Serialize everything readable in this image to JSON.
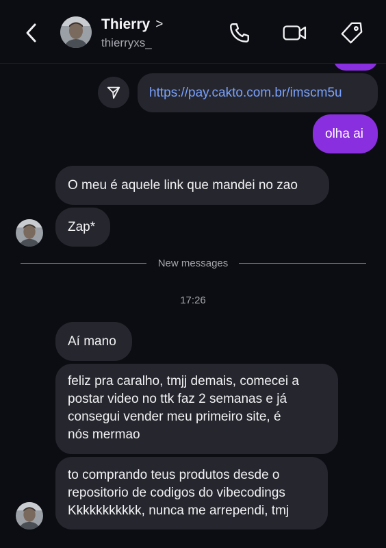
{
  "header": {
    "back_icon": "chevron-left-icon",
    "contact_name": "Thierry",
    "name_chevron": ">",
    "username": "thierryxs_",
    "actions": [
      {
        "icon": "phone-icon"
      },
      {
        "icon": "video-camera-icon"
      },
      {
        "icon": "tag-icon"
      }
    ]
  },
  "messages": {
    "link": "https://pay.cakto.com.br/imscm5u",
    "sent_1": "olha ai",
    "recv_1": "O meu é aquele link que mandei no zao",
    "recv_2": "Zap*",
    "new_messages_label": "New messages",
    "time": "17:26",
    "recv_3": "Aí mano",
    "recv_4_lines": [
      "feliz pra caralho, tmjj demais, comecei a",
      "postar video no ttk faz 2 semanas e já",
      "consegui vender meu primeiro site, é",
      "nós mermao"
    ],
    "recv_5_lines": [
      "to comprando teus produtos desde o",
      "repositorio de codigos do vibecodings",
      "Kkkkkkkkkkk, nunca me arrependi, tmj"
    ]
  },
  "colors": {
    "background": "#0c0d12",
    "incoming_bubble": "#26272e",
    "outgoing_bubble": "#8a2fe0",
    "link_text": "#7aa2ff",
    "secondary_text": "#a5a6ae"
  }
}
